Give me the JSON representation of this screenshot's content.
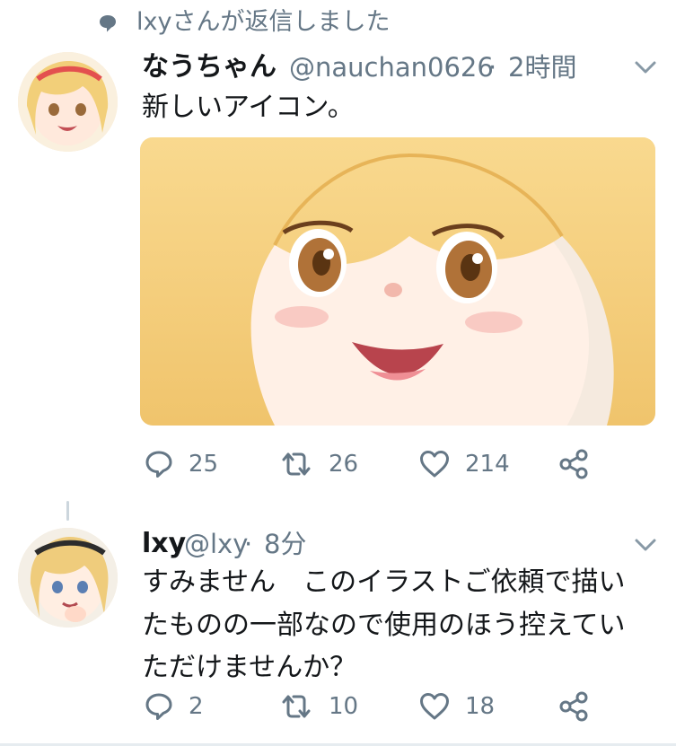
{
  "context": {
    "icon": "speech-bubble-icon",
    "text": "lxyさんが返信しました"
  },
  "tweets": [
    {
      "display_name": "なうちゃん",
      "handle": "@nauchan0626",
      "separator": "·",
      "time": "2時間",
      "text_lines": [
        "新しいアイコン。"
      ],
      "media": "anime-girl-illustration",
      "actions": {
        "reply_count": "25",
        "retweet_count": "26",
        "like_count": "214"
      }
    },
    {
      "display_name": "lxy",
      "handle": "@lxy",
      "separator": "·",
      "time": "8分",
      "text_lines": [
        "すみません　このイラストご依頼で描い",
        "たものの一部なので使用のほう控えてい",
        "ただけませんか？"
      ],
      "actions": {
        "reply_count": "2",
        "retweet_count": "10",
        "like_count": "18"
      }
    }
  ],
  "colors": {
    "text_primary": "#14171a",
    "text_secondary": "#657786",
    "icon_gray": "#657786",
    "divider": "#e6ecf0"
  }
}
